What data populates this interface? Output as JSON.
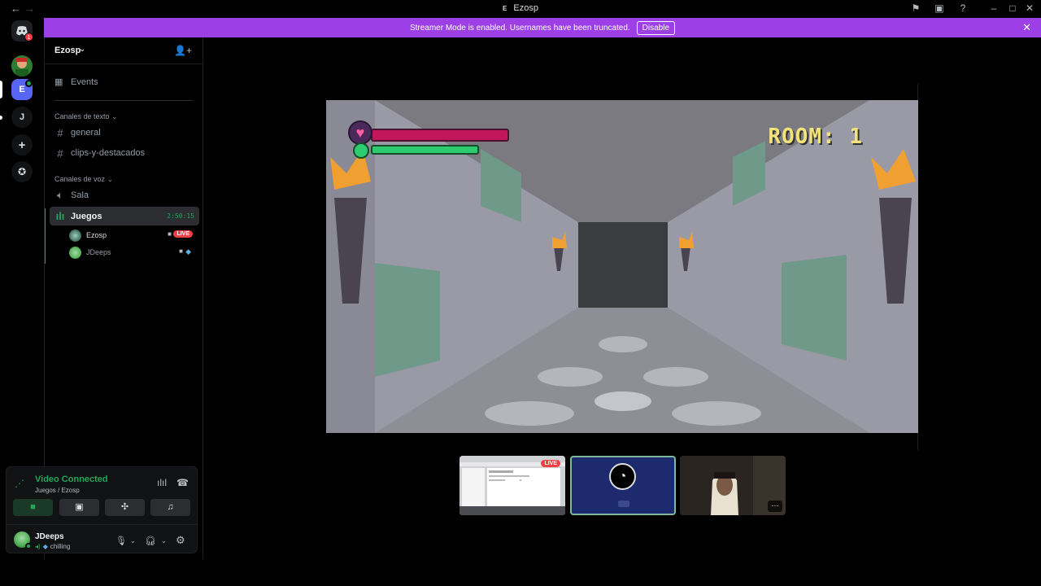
{
  "titlebar": {
    "title": "Ezosp",
    "badge": "E",
    "icons": [
      "back-arrow-icon",
      "forward-arrow-icon",
      "inbox-icon",
      "screen-share-icon",
      "help-icon",
      "minimize-icon",
      "maximize-icon",
      "close-icon"
    ]
  },
  "banner": {
    "message": "Streamer Mode is enabled. Usernames have been truncated.",
    "disable_label": "Disable"
  },
  "server_rail": {
    "discord_badge": "1",
    "servers": [
      {
        "label": "E"
      },
      {
        "label": "J"
      }
    ]
  },
  "sidebar": {
    "server_name": "Ezosp",
    "events_label": "Events",
    "text_category": "Canales de texto",
    "text_channels": [
      {
        "name": "general"
      },
      {
        "name": "clips-y-destacados"
      }
    ],
    "voice_category": "Canales de voz",
    "voice_channels": [
      {
        "name": "Sala"
      },
      {
        "name": "Juegos",
        "elapsed": "2:50:15"
      }
    ],
    "voice_users": [
      {
        "name": "Ezosp",
        "badge": "LIVE"
      },
      {
        "name": "JDeeps"
      }
    ]
  },
  "voice_panel": {
    "status": "Video Connected",
    "location": "Juegos / Ezosp"
  },
  "user": {
    "name": "JDeeps",
    "status": "chilling"
  },
  "stage": {
    "main_stream": {
      "room_label": "ROOM: 1",
      "health": 1.0,
      "stamina": 0.78
    },
    "thumbnails": [
      {
        "badge": "LIVE"
      },
      {},
      {
        "more_label": "···"
      }
    ]
  }
}
